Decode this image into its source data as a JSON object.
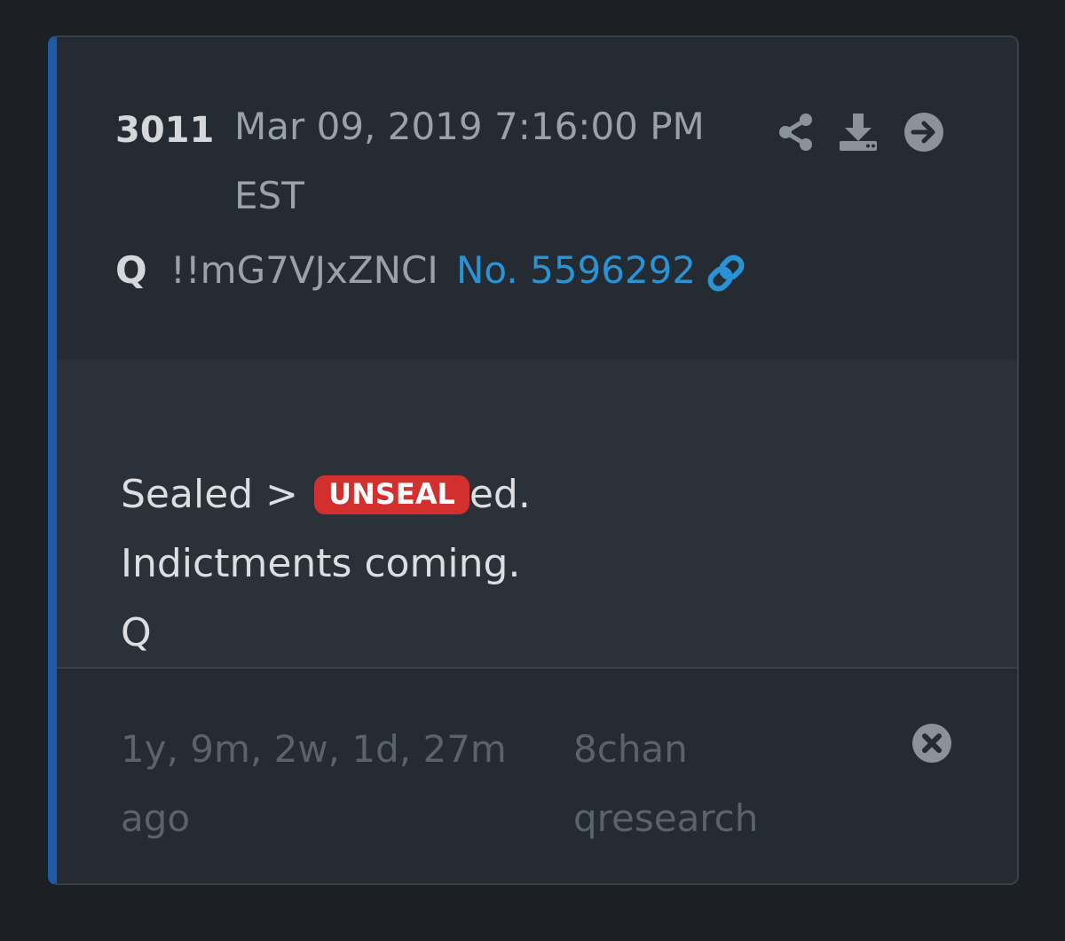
{
  "post": {
    "number": "3011",
    "date": "Mar 09, 2019 7:16:00 PM EST",
    "author": "Q",
    "tripcode": "!!mG7VJxZNCI",
    "post_link": "No. 5596292",
    "body": {
      "line1_before": "Sealed > ",
      "badge": "UNSEAL",
      "line1_after": "ed.",
      "line2": "Indictments coming.",
      "line3": "Q"
    },
    "footer": {
      "relative_time": "1y, 9m, 2w, 1d, 27m ago",
      "source": "8chan qresearch"
    }
  },
  "icons": {
    "share": "share-icon",
    "download": "download-icon",
    "go": "arrow-circle-right-icon",
    "link": "link-icon",
    "close": "times-circle-icon"
  },
  "colors": {
    "page_background": "#1c2025",
    "card_background": "#252b32",
    "body_background": "#2b3138",
    "accent_border": "#1d5aa8",
    "link": "#2a93d5",
    "badge": "#d32f2f",
    "muted_text": "#5b626b"
  }
}
